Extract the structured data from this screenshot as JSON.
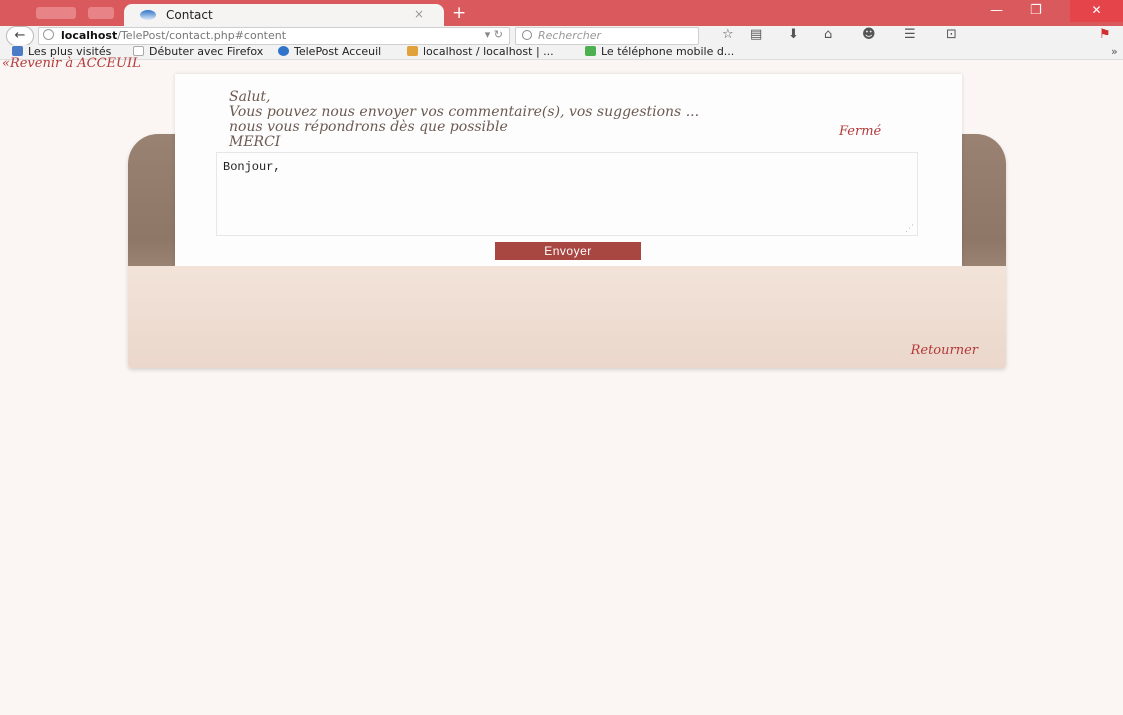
{
  "browser": {
    "tab_title": "Contact",
    "tab_close": "×",
    "new_tab": "+",
    "url_host": "localhost",
    "url_path": "/TelePost/contact.php#content",
    "search_placeholder": "Rechercher",
    "bookmarks": [
      {
        "label": "Les plus visités",
        "color": "#4a7bc7"
      },
      {
        "label": "Débuter avec Firefox",
        "color": "#dddddd"
      },
      {
        "label": "TelePost Acceuil",
        "color": "#2f74c9"
      },
      {
        "label": "localhost / localhost | ...",
        "color": "#e0a33b"
      },
      {
        "label": "Le téléphone mobile d...",
        "color": "#4caf50"
      }
    ],
    "more_bookmarks": "»",
    "accent_color": "#d9595d"
  },
  "page": {
    "back_home_link": "«Revenir à ACCEUIL",
    "message_lines": [
      "Salut,",
      "Vous pouvez nous envoyer vos commentaire(s), vos suggestions ...",
      "nous vous répondrons dès que possible",
      "MERCI"
    ],
    "close_link": "Fermé",
    "comment_value": "Bonjour,",
    "send_button": "Envoyer",
    "return_link": "Retourner"
  }
}
